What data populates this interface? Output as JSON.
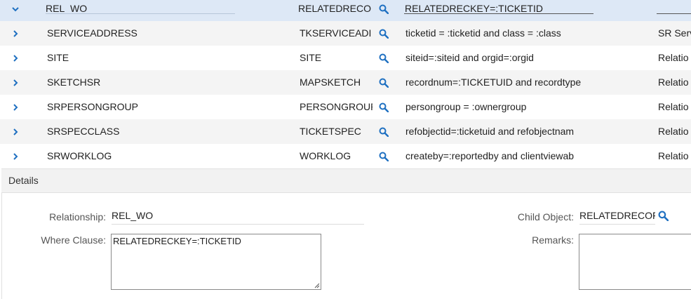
{
  "rows": [
    {
      "name": "REL_WO",
      "child_object": "RELATEDRECOF",
      "where": "RELATEDRECKEY=:TICKETID",
      "remarks": "",
      "expanded": true
    },
    {
      "name": "SERVICEADDRESS",
      "child_object": "TKSERVICEADI",
      "where": "ticketid = :ticketid and class = :class",
      "remarks": "SR Serv",
      "expanded": false
    },
    {
      "name": "SITE",
      "child_object": "SITE",
      "where": "siteid=:siteid and orgid=:orgid",
      "remarks": "Relatio",
      "expanded": false
    },
    {
      "name": "SKETCHSR",
      "child_object": "MAPSKETCH",
      "where": "recordnum=:TICKETUID and recordtype",
      "remarks": "Relatio",
      "expanded": false
    },
    {
      "name": "SRPERSONGROUP",
      "child_object": "PERSONGROUP",
      "where": "persongroup = :ownergroup",
      "remarks": "Relatio",
      "expanded": false
    },
    {
      "name": "SRSPECCLASS",
      "child_object": "TICKETSPEC",
      "where": "refobjectid=:ticketuid and refobjectnam",
      "remarks": "Relatio",
      "expanded": false
    },
    {
      "name": "SRWORKLOG",
      "child_object": "WORKLOG",
      "where": "createby=:reportedby and clientviewab",
      "remarks": "Relatio",
      "expanded": false
    }
  ],
  "details": {
    "header": "Details",
    "relationship_label": "Relationship:",
    "relationship_value": "REL_WO",
    "where_label": "Where Clause:",
    "where_value": "RELATEDRECKEY=:TICKETID",
    "child_object_label": "Child Object:",
    "child_object_value": "RELATEDRECOF",
    "remarks_label": "Remarks:",
    "remarks_value": ""
  },
  "icons": {
    "row_toggle": "chevron-icon",
    "lookup": "magnifier-icon",
    "resize": "resize-grip-icon"
  },
  "colors": {
    "accent": "#1f70c1",
    "expanded_row": "#dde8f6",
    "striped_row": "#f4f4f4",
    "details_header": "#f2f2f2"
  }
}
